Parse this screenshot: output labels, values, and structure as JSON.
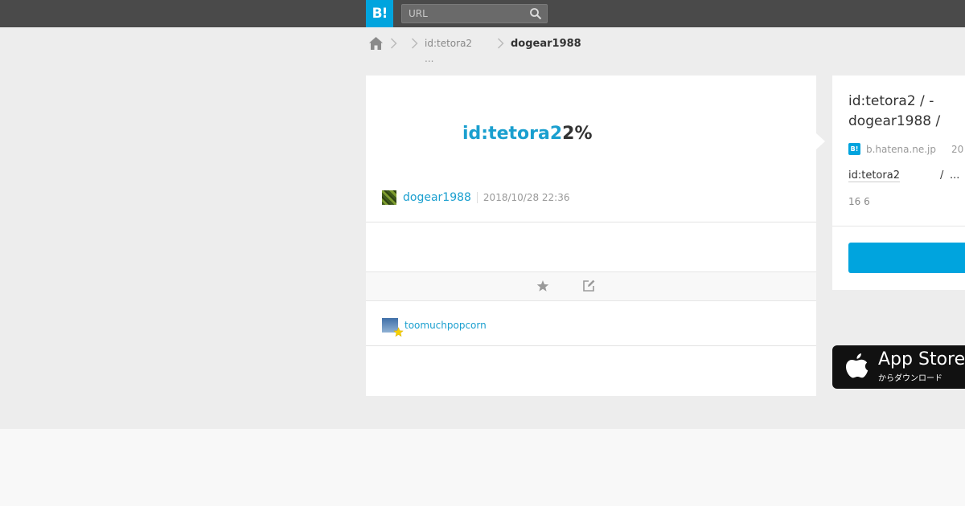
{
  "header": {
    "logo": "B!",
    "search_placeholder": "URL",
    "icons": [
      "search-icon"
    ]
  },
  "breadcrumb": {
    "home_icon": "home-icon",
    "items": [
      {
        "label": "id:tetora2",
        "more": "..."
      },
      {
        "label": "dogear1988"
      }
    ]
  },
  "main": {
    "headline_link": "id:tetora2",
    "headline_rest": "2%",
    "user": "dogear1988",
    "timestamp": "2018/10/28 22:36",
    "action_icons": [
      "star-icon",
      "edit-icon"
    ],
    "star_user": "toomuchpopcorn"
  },
  "sidebar": {
    "title": "id:tetora2 / - dogear1988 /",
    "favicon": "B!",
    "domain": "b.hatena.ne.jp",
    "date": "20",
    "owner": "id:tetora2",
    "slash": "/",
    "ellipsis": "...",
    "stats": "16 6"
  },
  "appstore": {
    "title": "App Store",
    "subtitle": "からダウンロード"
  },
  "colors": {
    "brand": "#00a4de",
    "link": "#1a9fcf",
    "topbar": "#4a4a4a",
    "star": "#f5d000"
  }
}
